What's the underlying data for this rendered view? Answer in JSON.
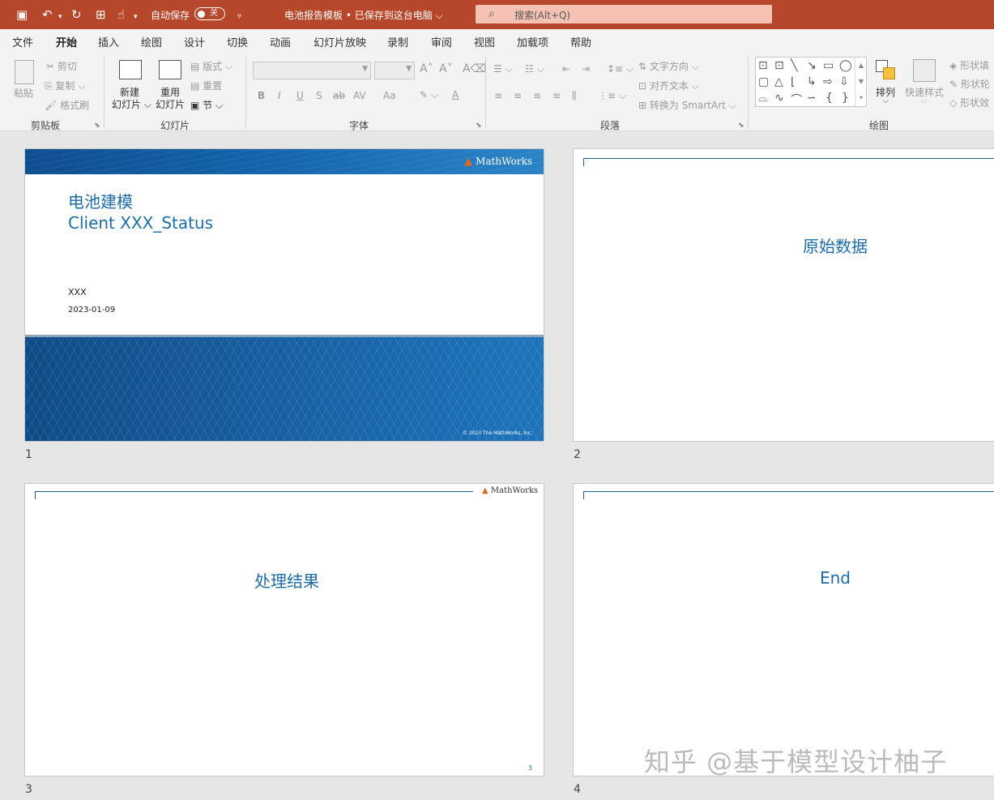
{
  "titlebar": {
    "autosave_label": "自动保存",
    "autosave_state": "关",
    "document_title": "电池报告模板 • 已保存到这台电脑",
    "search_placeholder": "搜索(Alt+Q)"
  },
  "tabs": [
    "文件",
    "开始",
    "插入",
    "绘图",
    "设计",
    "切换",
    "动画",
    "幻灯片放映",
    "录制",
    "审阅",
    "视图",
    "加载项",
    "帮助"
  ],
  "active_tab": "开始",
  "ribbon": {
    "clipboard": {
      "paste": "粘贴",
      "cut": "剪切",
      "copy": "复制",
      "format_painter": "格式刷",
      "group": "剪贴板"
    },
    "slides": {
      "new_slide": [
        "新建",
        "幻灯片"
      ],
      "reuse_slide": [
        "重用",
        "幻灯片"
      ],
      "layout": "版式",
      "reset": "重置",
      "section": "节",
      "group": "幻灯片"
    },
    "font": {
      "group": "字体",
      "buttons": [
        "B",
        "I",
        "U",
        "S",
        "ab",
        "AV",
        "Aa",
        "A"
      ]
    },
    "paragraph": {
      "text_direction": "文字方向",
      "align_text": "对齐文本",
      "smartart": "转换为 SmartArt",
      "group": "段落"
    },
    "drawing": {
      "arrange": "排列",
      "quick_styles": "快速样式",
      "shape_fill": "形状填",
      "shape_outline": "形状轮",
      "shape_effects": "形状效",
      "group": "绘图"
    }
  },
  "slides": [
    {
      "number": "1",
      "logo": "MathWorks",
      "title_line1": "电池建模",
      "title_line2": "Client XXX_Status",
      "author": "XXX",
      "date": "2023-01-09",
      "copyright": "© 2023 The MathWorks, Inc."
    },
    {
      "number": "2",
      "title": "原始数据"
    },
    {
      "number": "3",
      "title": "处理结果",
      "logo": "MathWorks",
      "page": "3"
    },
    {
      "number": "4",
      "title": "End"
    }
  ],
  "watermark": "知乎 @基于模型设计柚子"
}
